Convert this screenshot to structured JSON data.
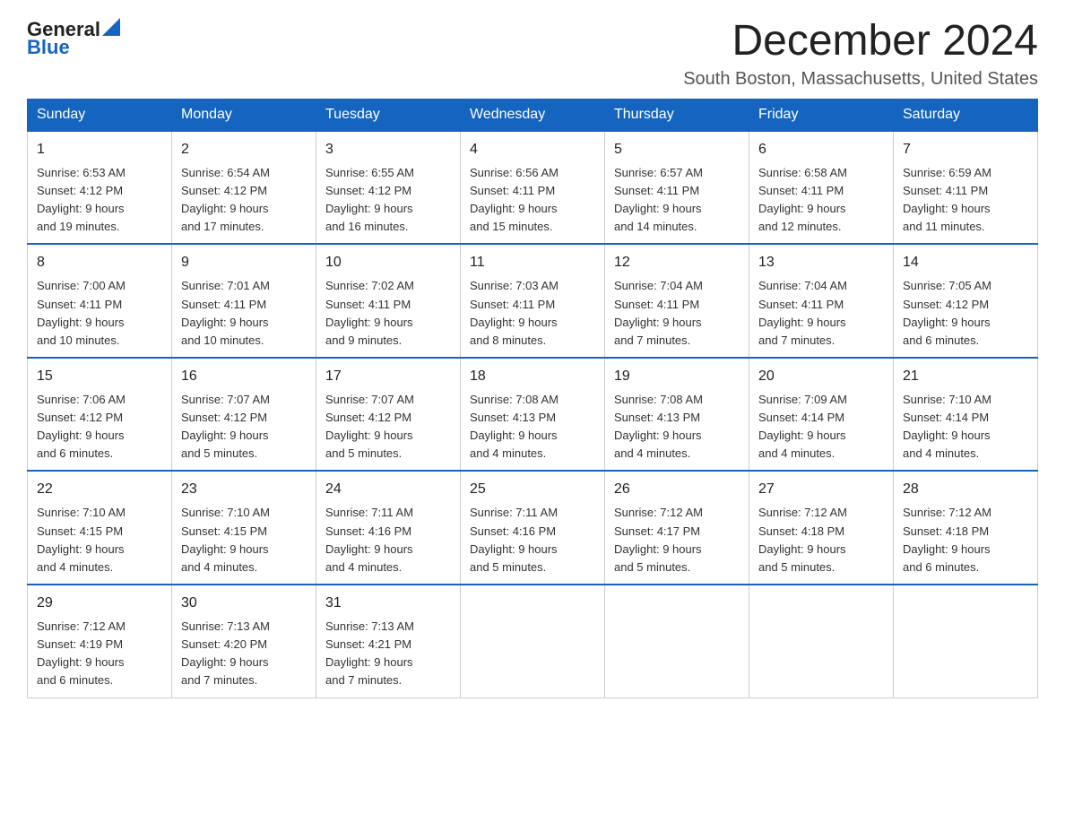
{
  "logo": {
    "text_general": "General",
    "text_blue": "Blue",
    "arrow_shape": "triangle"
  },
  "title": "December 2024",
  "location": "South Boston, Massachusetts, United States",
  "days_of_week": [
    "Sunday",
    "Monday",
    "Tuesday",
    "Wednesday",
    "Thursday",
    "Friday",
    "Saturday"
  ],
  "weeks": [
    [
      {
        "day": 1,
        "sunrise": "6:53 AM",
        "sunset": "4:12 PM",
        "daylight": "9 hours and 19 minutes."
      },
      {
        "day": 2,
        "sunrise": "6:54 AM",
        "sunset": "4:12 PM",
        "daylight": "9 hours and 17 minutes."
      },
      {
        "day": 3,
        "sunrise": "6:55 AM",
        "sunset": "4:12 PM",
        "daylight": "9 hours and 16 minutes."
      },
      {
        "day": 4,
        "sunrise": "6:56 AM",
        "sunset": "4:11 PM",
        "daylight": "9 hours and 15 minutes."
      },
      {
        "day": 5,
        "sunrise": "6:57 AM",
        "sunset": "4:11 PM",
        "daylight": "9 hours and 14 minutes."
      },
      {
        "day": 6,
        "sunrise": "6:58 AM",
        "sunset": "4:11 PM",
        "daylight": "9 hours and 12 minutes."
      },
      {
        "day": 7,
        "sunrise": "6:59 AM",
        "sunset": "4:11 PM",
        "daylight": "9 hours and 11 minutes."
      }
    ],
    [
      {
        "day": 8,
        "sunrise": "7:00 AM",
        "sunset": "4:11 PM",
        "daylight": "9 hours and 10 minutes."
      },
      {
        "day": 9,
        "sunrise": "7:01 AM",
        "sunset": "4:11 PM",
        "daylight": "9 hours and 10 minutes."
      },
      {
        "day": 10,
        "sunrise": "7:02 AM",
        "sunset": "4:11 PM",
        "daylight": "9 hours and 9 minutes."
      },
      {
        "day": 11,
        "sunrise": "7:03 AM",
        "sunset": "4:11 PM",
        "daylight": "9 hours and 8 minutes."
      },
      {
        "day": 12,
        "sunrise": "7:04 AM",
        "sunset": "4:11 PM",
        "daylight": "9 hours and 7 minutes."
      },
      {
        "day": 13,
        "sunrise": "7:04 AM",
        "sunset": "4:11 PM",
        "daylight": "9 hours and 7 minutes."
      },
      {
        "day": 14,
        "sunrise": "7:05 AM",
        "sunset": "4:12 PM",
        "daylight": "9 hours and 6 minutes."
      }
    ],
    [
      {
        "day": 15,
        "sunrise": "7:06 AM",
        "sunset": "4:12 PM",
        "daylight": "9 hours and 6 minutes."
      },
      {
        "day": 16,
        "sunrise": "7:07 AM",
        "sunset": "4:12 PM",
        "daylight": "9 hours and 5 minutes."
      },
      {
        "day": 17,
        "sunrise": "7:07 AM",
        "sunset": "4:12 PM",
        "daylight": "9 hours and 5 minutes."
      },
      {
        "day": 18,
        "sunrise": "7:08 AM",
        "sunset": "4:13 PM",
        "daylight": "9 hours and 4 minutes."
      },
      {
        "day": 19,
        "sunrise": "7:08 AM",
        "sunset": "4:13 PM",
        "daylight": "9 hours and 4 minutes."
      },
      {
        "day": 20,
        "sunrise": "7:09 AM",
        "sunset": "4:14 PM",
        "daylight": "9 hours and 4 minutes."
      },
      {
        "day": 21,
        "sunrise": "7:10 AM",
        "sunset": "4:14 PM",
        "daylight": "9 hours and 4 minutes."
      }
    ],
    [
      {
        "day": 22,
        "sunrise": "7:10 AM",
        "sunset": "4:15 PM",
        "daylight": "9 hours and 4 minutes."
      },
      {
        "day": 23,
        "sunrise": "7:10 AM",
        "sunset": "4:15 PM",
        "daylight": "9 hours and 4 minutes."
      },
      {
        "day": 24,
        "sunrise": "7:11 AM",
        "sunset": "4:16 PM",
        "daylight": "9 hours and 4 minutes."
      },
      {
        "day": 25,
        "sunrise": "7:11 AM",
        "sunset": "4:16 PM",
        "daylight": "9 hours and 5 minutes."
      },
      {
        "day": 26,
        "sunrise": "7:12 AM",
        "sunset": "4:17 PM",
        "daylight": "9 hours and 5 minutes."
      },
      {
        "day": 27,
        "sunrise": "7:12 AM",
        "sunset": "4:18 PM",
        "daylight": "9 hours and 5 minutes."
      },
      {
        "day": 28,
        "sunrise": "7:12 AM",
        "sunset": "4:18 PM",
        "daylight": "9 hours and 6 minutes."
      }
    ],
    [
      {
        "day": 29,
        "sunrise": "7:12 AM",
        "sunset": "4:19 PM",
        "daylight": "9 hours and 6 minutes."
      },
      {
        "day": 30,
        "sunrise": "7:13 AM",
        "sunset": "4:20 PM",
        "daylight": "9 hours and 7 minutes."
      },
      {
        "day": 31,
        "sunrise": "7:13 AM",
        "sunset": "4:21 PM",
        "daylight": "9 hours and 7 minutes."
      },
      null,
      null,
      null,
      null
    ]
  ],
  "labels": {
    "sunrise": "Sunrise:",
    "sunset": "Sunset:",
    "daylight": "Daylight:"
  }
}
